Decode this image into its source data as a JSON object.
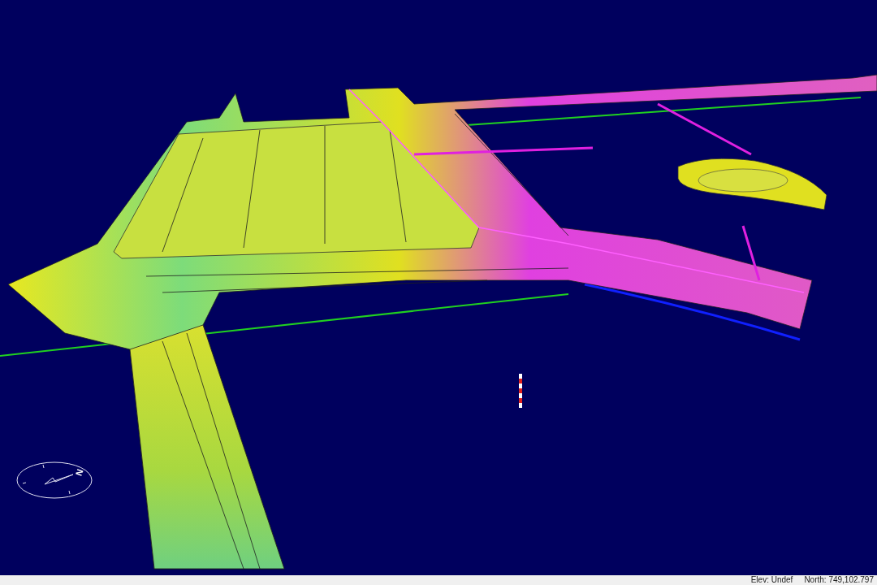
{
  "viewport": {
    "compass": {
      "north_label": "N"
    }
  },
  "status_bar": {
    "fields": [
      "Elev: Undef",
      "North: 749,102.797"
    ]
  }
}
